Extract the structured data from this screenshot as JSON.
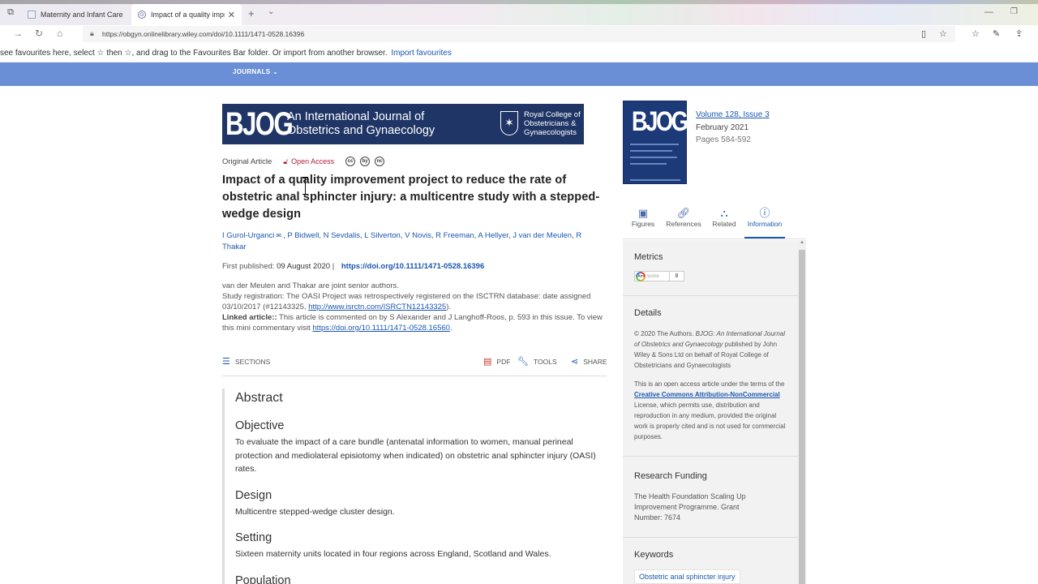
{
  "browser": {
    "tabs": [
      {
        "title": "Maternity and Infant Care",
        "active": false
      },
      {
        "title": "Impact of a quality impr",
        "active": true
      }
    ],
    "url": "https://obgyn.onlinelibrary.wiley.com/doi/10.1111/1471-0528.16396",
    "favourites_bar": {
      "text": "see favourites here, select  ☆  then ☆, and drag to the Favourites Bar folder. Or import from another browser.",
      "link": "Import favourites"
    }
  },
  "site": {
    "nav_label": "JOURNALS",
    "banner": {
      "abbr": "BJOG",
      "title_line1": "An International Journal of",
      "title_line2": "Obstetrics and Gynaecology",
      "society_line1": "Royal College of",
      "society_line2": "Obstetricians &",
      "society_line3": "Gynaecologists"
    }
  },
  "article": {
    "type": "Original Article",
    "access": "Open Access",
    "license_icons": [
      "cc",
      "by",
      "nc"
    ],
    "title": "Impact of a quality improvement project to reduce the rate of obstetric anal sphincter injury: a multicentre study with a stepped-wedge design",
    "authors": [
      "I Gurol-Urganci",
      "P Bidwell",
      "N Sevdalis",
      "L Silverton",
      "V Novis",
      "R Freeman",
      "A Hellyer",
      "J van der Meulen",
      "R Thakar"
    ],
    "first_published_label": "First published:",
    "first_published_date": "09 August 2020",
    "doi": "https://doi.org/10.1111/1471-0528.16396",
    "note_senior": "van der Meulen and Thakar are joint senior authors.",
    "note_registration": "Study registration: The OASI Project was retrospectively registered on the ISCTRN database: date assigned 03/10/2017 (#12143325,",
    "registration_link": "http://www.isrctn.com/ISRCTN12143325",
    "registration_tail": ").",
    "linked_label": "Linked article::",
    "linked_text": "This article is commented on by S Alexander and J Langhoff-Roos, p. 593 in this issue. To view this mini commentary visit",
    "linked_link": "https://doi.org/10.1111/1471-0528.16560",
    "linked_tail": "."
  },
  "toolbar": {
    "sections": "SECTIONS",
    "pdf": "PDF",
    "tools": "TOOLS",
    "share": "SHARE"
  },
  "abstract": {
    "heading": "Abstract",
    "objective_h": "Objective",
    "objective": "To evaluate the impact of a care bundle (antenatal information to women, manual perineal protection and mediolateral episiotomy when indicated) on obstetric anal sphincter injury (OASI) rates.",
    "design_h": "Design",
    "design": "Multicentre stepped-wedge cluster design.",
    "setting_h": "Setting",
    "setting": "Sixteen maternity units located in four regions across England, Scotland and Wales.",
    "population_h": "Population"
  },
  "sidebar": {
    "cover_abbr": "BJOG",
    "volume_label": "Volume",
    "volume": "128",
    "issue_label": "Issue",
    "issue": "3",
    "date": "February 2021",
    "pages": "Pages 584-592",
    "tabs": [
      {
        "label": "Figures",
        "icon": "image-icon"
      },
      {
        "label": "References",
        "icon": "link-icon"
      },
      {
        "label": "Related",
        "icon": "network-icon"
      },
      {
        "label": "Information",
        "icon": "info-icon",
        "active": true
      }
    ],
    "metrics_h": "Metrics",
    "altmetric_label": "score",
    "altmetric_abbr": "Am",
    "altmetric_score": "8",
    "details_h": "Details",
    "copyright_pre": "© 2020 The Authors.",
    "copyright_journal": "BJOG: An International Journal of Obstetrics and Gynaecology",
    "copyright_post": "published by John Wiley & Sons Ltd on behalf of Royal College of Obstetricians and Gynaecologists",
    "license_pre": "This is an open access article under the terms of the",
    "license_link": "Creative Commons Attribution-NonCommercial",
    "license_post": "License, which permits use, distribution and reproduction in any medium, provided the original work is properly cited and is not used for commercial purposes.",
    "funding_h": "Research Funding",
    "funding": "The Health Foundation Scaling Up Improvement Programme. Grant Number: 7674",
    "keywords_h": "Keywords",
    "keyword1": "Obstetric anal sphincter injury"
  }
}
